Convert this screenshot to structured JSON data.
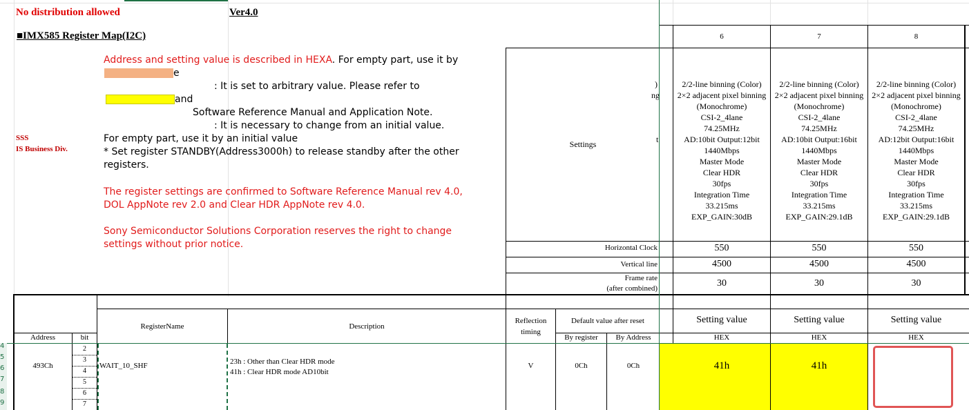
{
  "header": {
    "no_distribution": "No distribution allowed",
    "version": "Ver4.0",
    "map_title": "■IMX585 Register Map(I2C)"
  },
  "company": {
    "line1": "SSS",
    "line2": "IS Business Div."
  },
  "notes": {
    "line1_red": "Address and setting value is described in HEXA",
    "line1_black": ". For empty part, use it by",
    "line2_tail": "e",
    "line3": ": It is set to arbitrary value. Please refer to",
    "line4_tail": "and",
    "line5": "Software Reference Manual and Application Note.",
    "line6": ": It is necessary to change from an initial value.",
    "line7": "For empty part, use it by an initial value",
    "line8": "* Set register STANDBY(Address3000h) to release standby after the other",
    "line9": "registers.",
    "confirm1": "The register settings are confirmed to Software Reference Manual rev 4.0,",
    "confirm2": "DOL AppNote rev 2.0 and Clear HDR AppNote rev 4.0.",
    "rights1": "Sony Semiconductor Solutions Corporation reserves the right to change",
    "rights2": "settings without  prior notice."
  },
  "swatch_colors": {
    "orange": "#f4b183",
    "yellow": "#ffff00"
  },
  "labels": {
    "settings": "Settings",
    "horizontal_clock": "Horizontal Clock",
    "vertical_line": "Vertical line",
    "frame_rate_1": "Frame rate",
    "frame_rate_2": "(after combined)",
    "partial_col": [
      ")",
      "ng",
      "t"
    ]
  },
  "columns": [
    {
      "num": "6",
      "lines": [
        "2/2-line binning (Color)",
        "2×2 adjacent pixel binning",
        "(Monochrome)",
        "CSI-2_4lane",
        "74.25MHz",
        "AD:10bit Output:12bit",
        "1440Mbps",
        "Master Mode",
        "Clear HDR",
        "30fps",
        "Integration Time",
        "33.215ms",
        "EXP_GAIN:30dB"
      ],
      "hclk": "550",
      "vline": "4500",
      "frame": "30",
      "setting_value": "Setting value",
      "hex": "HEX",
      "value": "41h"
    },
    {
      "num": "7",
      "lines": [
        "2/2-line binning (Color)",
        "2×2 adjacent pixel binning",
        "(Monochrome)",
        "CSI-2_4lane",
        "74.25MHz",
        "AD:10bit Output:16bit",
        "1440Mbps",
        "Master Mode",
        "Clear HDR",
        "30fps",
        "Integration Time",
        "33.215ms",
        "EXP_GAIN:29.1dB"
      ],
      "hclk": "550",
      "vline": "4500",
      "frame": "30",
      "setting_value": "Setting value",
      "hex": "HEX",
      "value": "41h"
    },
    {
      "num": "8",
      "lines": [
        "2/2-line binning (Color)",
        "2×2 adjacent pixel binning",
        "(Monochrome)",
        "CSI-2_4lane",
        "74.25MHz",
        "AD:12bit Output:16bit",
        "1440Mbps",
        "Master Mode",
        "Clear HDR",
        "30fps",
        "Integration Time",
        "33.215ms",
        "EXP_GAIN:29.1dB"
      ],
      "hclk": "550",
      "vline": "4500",
      "frame": "30",
      "setting_value": "Setting value",
      "hex": "HEX",
      "value": ""
    }
  ],
  "table_header": {
    "address": "Address",
    "bit": "bit",
    "register_name": "RegisterName",
    "description": "Description",
    "reflection_1": "Reflection",
    "reflection_2": "timing",
    "default_after_reset": "Default value after reset",
    "by_register": "By register",
    "by_address": "By Address"
  },
  "row": {
    "address": "493Ch",
    "bits": [
      "2",
      "3",
      "4",
      "5",
      "6",
      "7"
    ],
    "register_name": "WAIT_10_SHF",
    "desc1": "23h : Other than Clear HDR mode",
    "desc2": "41h : Clear HDR mode AD10bit",
    "reflection": "V",
    "by_register": "0Ch",
    "by_address": "0Ch"
  },
  "row_numbers": [
    "4",
    "5",
    "6",
    "7",
    "8",
    "9"
  ]
}
